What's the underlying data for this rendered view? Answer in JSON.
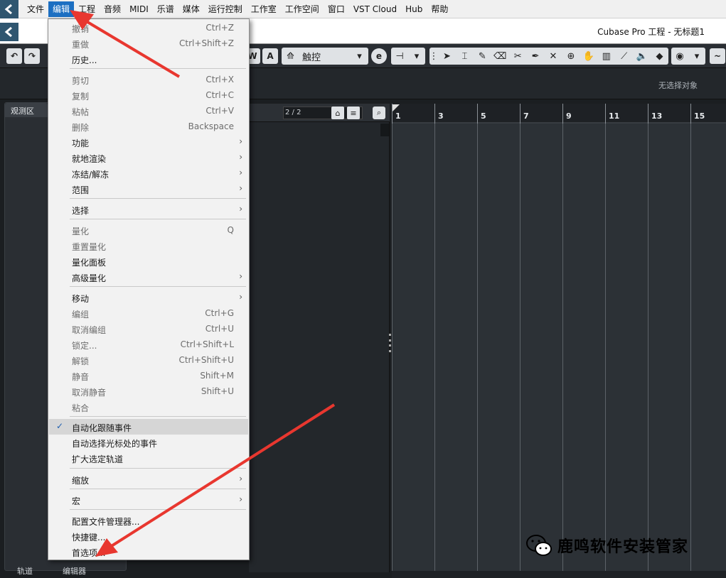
{
  "menubar": {
    "items": [
      "文件",
      "编辑",
      "工程",
      "音频",
      "MIDI",
      "乐谱",
      "媒体",
      "运行控制",
      "工作室",
      "工作空间",
      "窗口",
      "VST Cloud",
      "Hub",
      "帮助"
    ]
  },
  "titlebar": {
    "title": "Cubase Pro 工程 - 无标题1"
  },
  "toolbar": {
    "undo_label": "↶",
    "redo_label": "↷",
    "w_label": "W",
    "a_label": "A",
    "mode_label": "触控",
    "e_label": "e"
  },
  "infobar": {
    "no_selection": "无选择对象"
  },
  "left_zone": {
    "tab": "观测区",
    "bottom_tab_left": "轨道",
    "bottom_tab_right": "编辑器"
  },
  "tracklist": {
    "counter": "2 / 2"
  },
  "ruler": {
    "bars": [
      "1",
      "3",
      "5",
      "7",
      "9",
      "11",
      "13",
      "15"
    ]
  },
  "edit_menu": {
    "items": [
      {
        "label": "撤销",
        "shortcut": "Ctrl+Z",
        "disabled": true
      },
      {
        "label": "重做",
        "shortcut": "Ctrl+Shift+Z",
        "disabled": true
      },
      {
        "label": "历史...",
        "shortcut": "",
        "disabled": false
      },
      {
        "label": "剪切",
        "shortcut": "Ctrl+X",
        "disabled": true
      },
      {
        "label": "复制",
        "shortcut": "Ctrl+C",
        "disabled": true
      },
      {
        "label": "粘帖",
        "shortcut": "Ctrl+V",
        "disabled": true
      },
      {
        "label": "删除",
        "shortcut": "Backspace",
        "disabled": true
      },
      {
        "label": "功能",
        "shortcut": "",
        "disabled": false,
        "submenu": true
      },
      {
        "label": "就地渲染",
        "shortcut": "",
        "disabled": false,
        "submenu": true
      },
      {
        "label": "冻结/解冻",
        "shortcut": "",
        "disabled": false,
        "submenu": true
      },
      {
        "label": "范围",
        "shortcut": "",
        "disabled": false,
        "submenu": true
      },
      {
        "label": "选择",
        "shortcut": "",
        "disabled": false,
        "submenu": true
      },
      {
        "label": "量化",
        "shortcut": "Q",
        "disabled": true
      },
      {
        "label": "重置量化",
        "shortcut": "",
        "disabled": true
      },
      {
        "label": "量化面板",
        "shortcut": "",
        "disabled": false
      },
      {
        "label": "高级量化",
        "shortcut": "",
        "disabled": false,
        "submenu": true
      },
      {
        "label": "移动",
        "shortcut": "",
        "disabled": false,
        "submenu": true
      },
      {
        "label": "编组",
        "shortcut": "Ctrl+G",
        "disabled": true
      },
      {
        "label": "取消编组",
        "shortcut": "Ctrl+U",
        "disabled": true
      },
      {
        "label": "锁定...",
        "shortcut": "Ctrl+Shift+L",
        "disabled": true
      },
      {
        "label": "解锁",
        "shortcut": "Ctrl+Shift+U",
        "disabled": true
      },
      {
        "label": "静音",
        "shortcut": "Shift+M",
        "disabled": true
      },
      {
        "label": "取消静音",
        "shortcut": "Shift+U",
        "disabled": true
      },
      {
        "label": "粘合",
        "shortcut": "",
        "disabled": true
      },
      {
        "label": "自动化跟随事件",
        "shortcut": "",
        "disabled": false,
        "checked": true
      },
      {
        "label": "自动选择光标处的事件",
        "shortcut": "",
        "disabled": false
      },
      {
        "label": "扩大选定轨道",
        "shortcut": "",
        "disabled": false
      },
      {
        "label": "缩放",
        "shortcut": "",
        "disabled": false,
        "submenu": true
      },
      {
        "label": "宏",
        "shortcut": "",
        "disabled": false,
        "submenu": true
      },
      {
        "label": "配置文件管理器...",
        "shortcut": "",
        "disabled": false
      },
      {
        "label": "快捷键...",
        "shortcut": "",
        "disabled": false
      },
      {
        "label": "首选项...",
        "shortcut": "",
        "disabled": false
      }
    ]
  },
  "watermark": {
    "text": "鹿鸣软件安装管家"
  },
  "colors": {
    "accent": "#1c6fc2",
    "arrow": "#e8372f",
    "check": "#1f5fb0"
  }
}
